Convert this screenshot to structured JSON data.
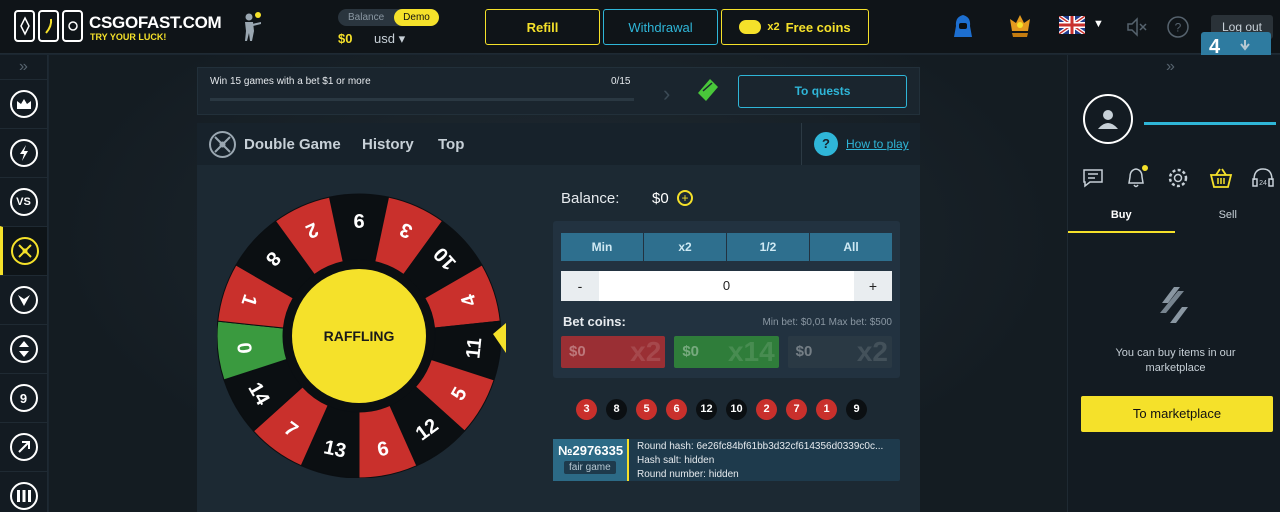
{
  "header": {
    "brand_name": "CSGOFAST.COM",
    "brand_tagline": "TRY YOUR LUCK!",
    "balance_label": "Balance",
    "demo_label": "Demo",
    "balance_amount": "$0",
    "currency": "usd",
    "refill_label": "Refill",
    "withdraw_label": "Withdrawal",
    "freecoins_mult": "x2",
    "freecoins_label": "Free coins",
    "logout_label": "Log out"
  },
  "quest": {
    "text": "Win 15 games with a bet $1 or more",
    "progress": "0/15",
    "button": "To quests"
  },
  "game": {
    "tabs": [
      "Double Game",
      "History",
      "Top"
    ],
    "how_to_play": "How to play",
    "wheel_center": "RAFFLING",
    "wheel_numbers": [
      "9",
      "3",
      "10",
      "4",
      "11",
      "5",
      "12",
      "6",
      "13",
      "7",
      "14",
      "0",
      "1",
      "8",
      "2"
    ],
    "balance_label": "Balance:",
    "balance_value": "$0",
    "quick_buttons": [
      "Min",
      "x2",
      "1/2",
      "All"
    ],
    "bet_value": "0",
    "bet_coins_label": "Bet coins:",
    "min_max_text": "Min bet: $0,01 Max bet: $500",
    "coins": [
      {
        "amount": "$0",
        "mult": "x2"
      },
      {
        "amount": "$0",
        "mult": "x14"
      },
      {
        "amount": "$0",
        "mult": "x2"
      }
    ],
    "history": [
      {
        "n": "3",
        "c": "red"
      },
      {
        "n": "8",
        "c": "black"
      },
      {
        "n": "5",
        "c": "red"
      },
      {
        "n": "6",
        "c": "red"
      },
      {
        "n": "12",
        "c": "black"
      },
      {
        "n": "10",
        "c": "black"
      },
      {
        "n": "2",
        "c": "red"
      },
      {
        "n": "7",
        "c": "red"
      },
      {
        "n": "1",
        "c": "red"
      },
      {
        "n": "9",
        "c": "black"
      }
    ],
    "round_number": "№2976335",
    "fair_label": "fair game",
    "round_hash": "Round hash: 6e26fc84bf61bb3d32cf614356d0339c0c...",
    "hash_salt": "Hash salt: hidden",
    "round_num_text": "Round number: hidden"
  },
  "right_panel": {
    "tab_buy": "Buy",
    "tab_sell": "Sell",
    "market_text": "You can buy items in our marketplace",
    "market_button": "To marketplace"
  },
  "colors": {
    "accent": "#f5e12a",
    "cyan": "#2fb6d8",
    "red": "#c9302c",
    "green": "#3a9a3f",
    "black": "#0b0f12"
  }
}
